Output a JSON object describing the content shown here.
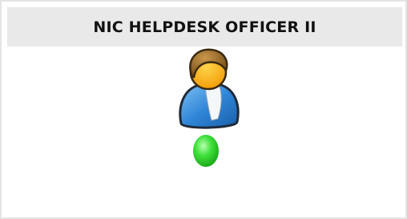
{
  "header": {
    "title": "NIC HELPDESK OFFICER II"
  },
  "user": {
    "avatar_icon": "user-avatar-icon",
    "status_icon": "online-status-icon",
    "status_color": "#2fd12f"
  }
}
